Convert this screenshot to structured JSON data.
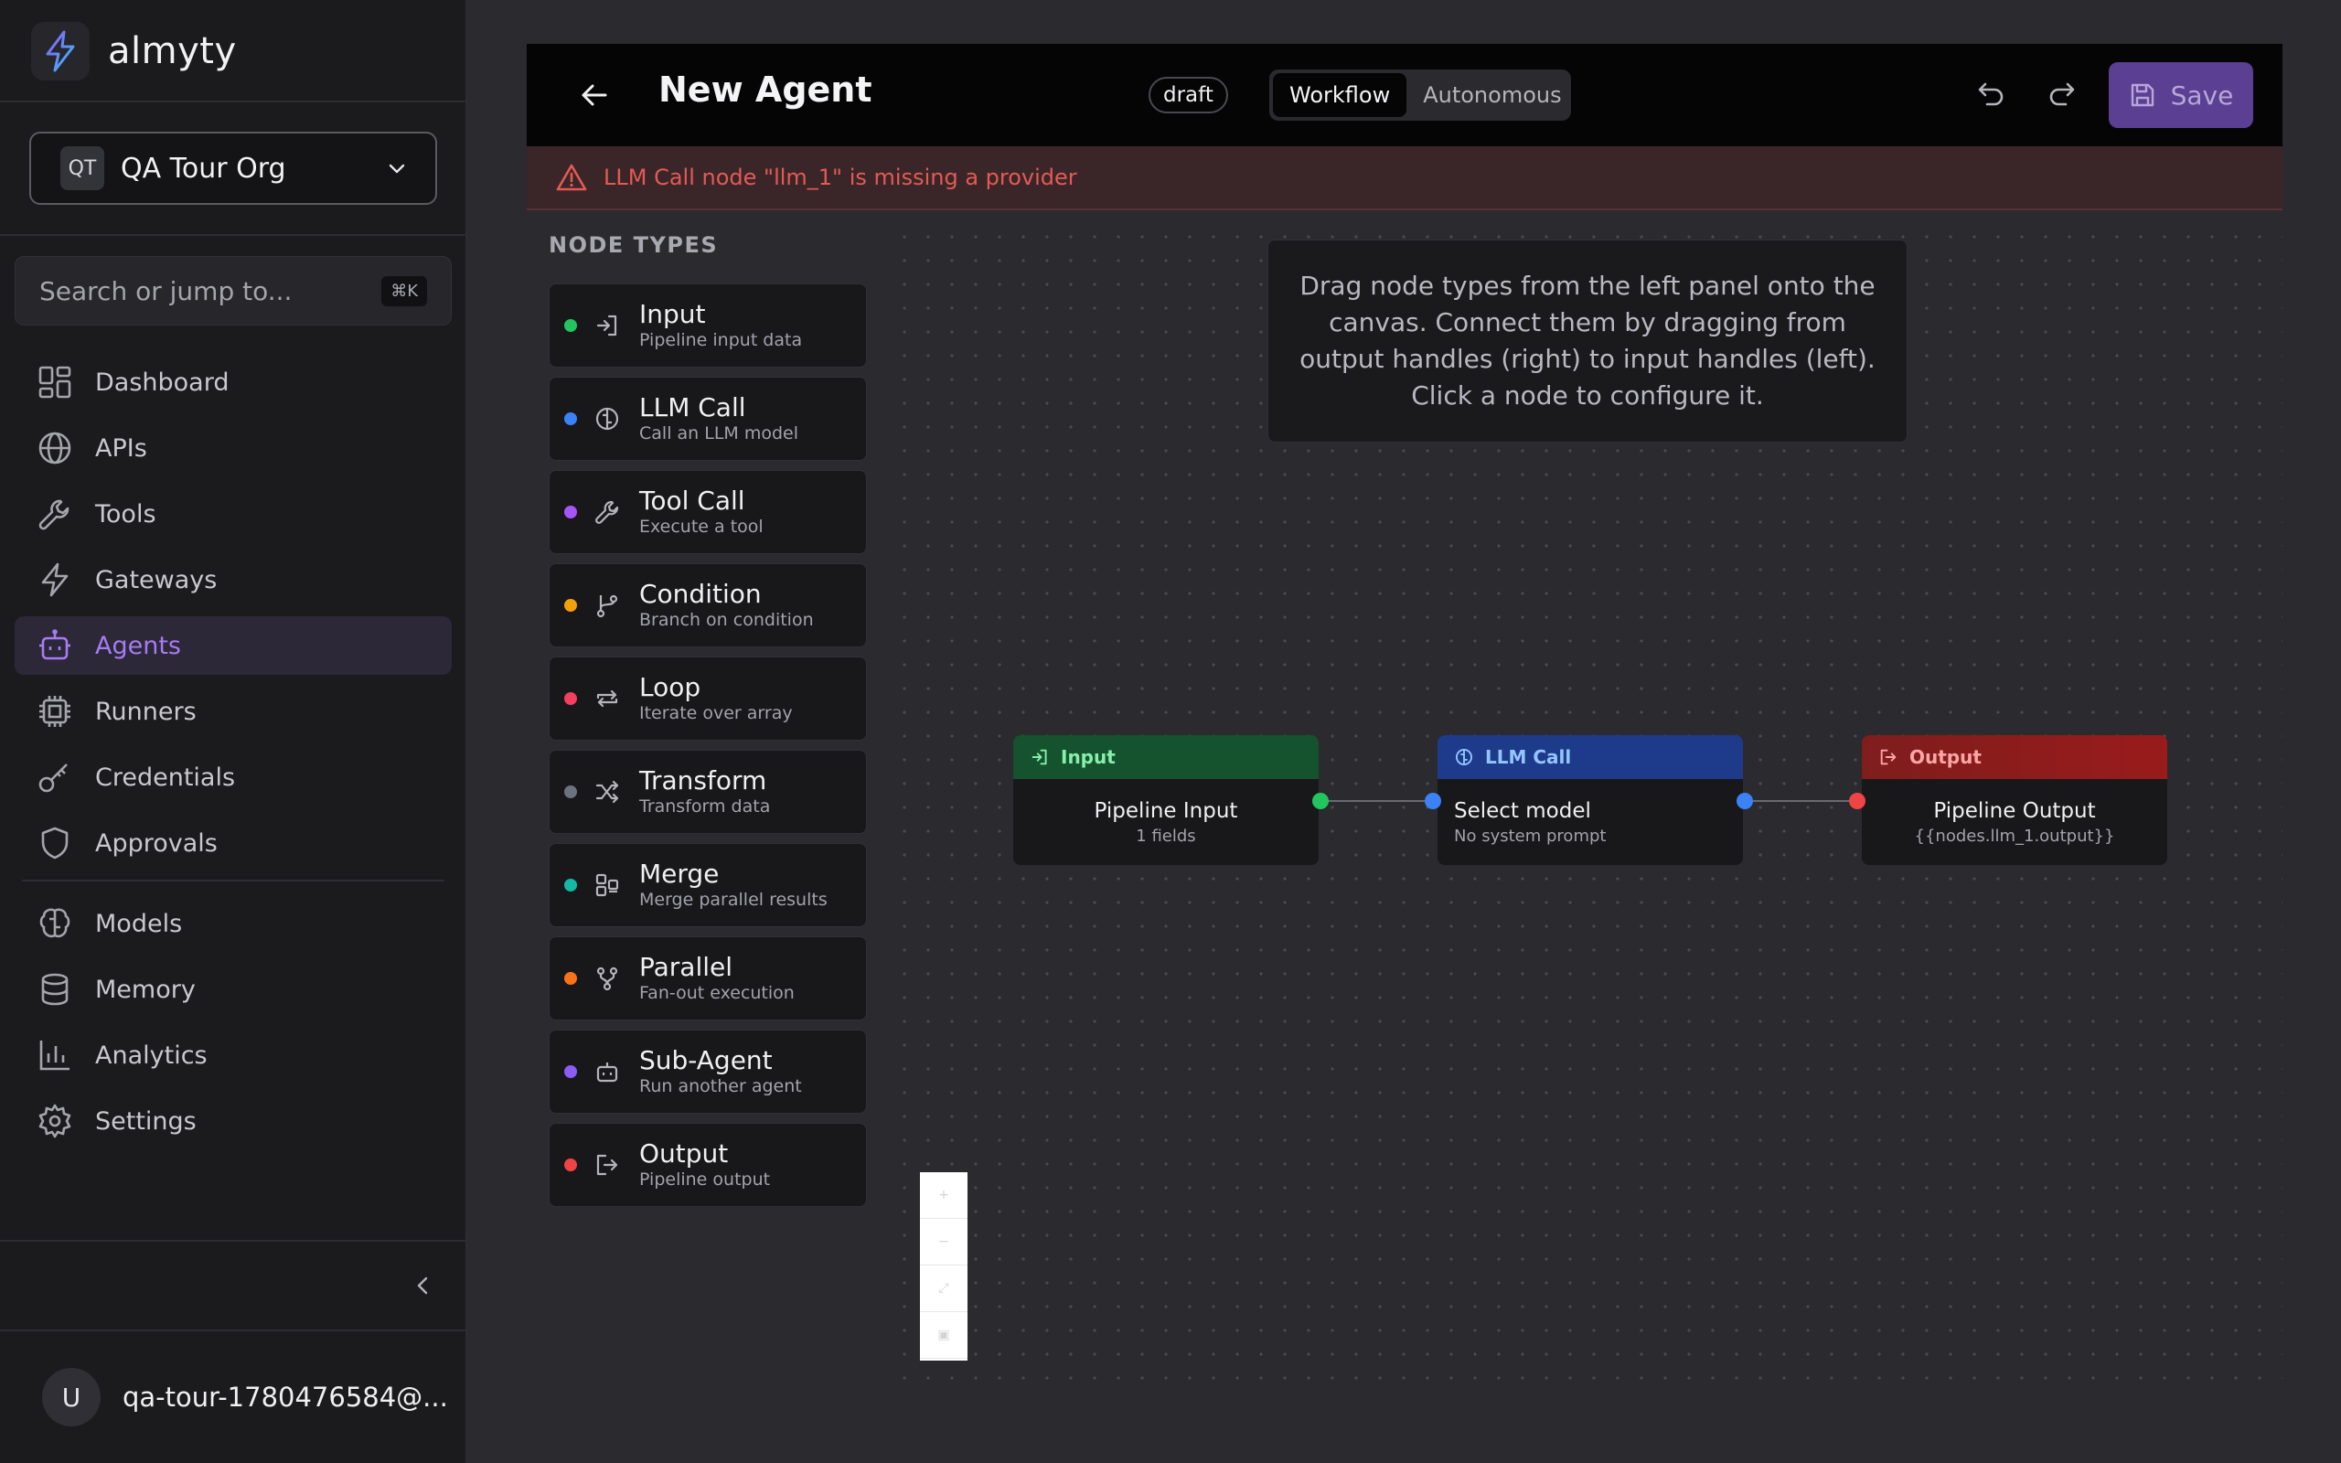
{
  "app": {
    "name": "almyty"
  },
  "org": {
    "initials": "QT",
    "name": "QA Tour Org"
  },
  "search": {
    "placeholder": "Search or jump to...",
    "shortcut": "⌘K"
  },
  "nav": {
    "items": [
      {
        "label": "Dashboard",
        "icon": "dashboard-icon"
      },
      {
        "label": "APIs",
        "icon": "globe-icon"
      },
      {
        "label": "Tools",
        "icon": "wrench-icon"
      },
      {
        "label": "Gateways",
        "icon": "lightning-icon"
      },
      {
        "label": "Agents",
        "icon": "robot-icon",
        "active": true
      },
      {
        "label": "Runners",
        "icon": "cpu-icon"
      },
      {
        "label": "Credentials",
        "icon": "key-icon"
      },
      {
        "label": "Approvals",
        "icon": "shield-icon"
      }
    ],
    "items_secondary": [
      {
        "label": "Models",
        "icon": "brain-icon"
      },
      {
        "label": "Memory",
        "icon": "database-icon"
      },
      {
        "label": "Analytics",
        "icon": "bar-chart-icon"
      },
      {
        "label": "Settings",
        "icon": "gear-icon"
      }
    ]
  },
  "user": {
    "initial": "U",
    "email": "qa-tour-1780476584@..."
  },
  "header": {
    "title": "New Agent",
    "status_badge": "draft",
    "modes": [
      "Workflow",
      "Autonomous"
    ],
    "active_mode": "Workflow",
    "save_label": "Save"
  },
  "error": {
    "message": "LLM Call node \"llm_1\" is missing a provider"
  },
  "node_panel": {
    "title": "NODE TYPES",
    "types": [
      {
        "title": "Input",
        "desc": "Pipeline input data",
        "color": "#22c55e",
        "icon": "enter-icon"
      },
      {
        "title": "LLM Call",
        "desc": "Call an LLM model",
        "color": "#3b82f6",
        "icon": "brain-icon"
      },
      {
        "title": "Tool Call",
        "desc": "Execute a tool",
        "color": "#a855f7",
        "icon": "wrench-icon"
      },
      {
        "title": "Condition",
        "desc": "Branch on condition",
        "color": "#f59e0b",
        "icon": "branch-icon"
      },
      {
        "title": "Loop",
        "desc": "Iterate over array",
        "color": "#f43f5e",
        "icon": "loop-icon"
      },
      {
        "title": "Transform",
        "desc": "Transform data",
        "color": "#6b7280",
        "icon": "shuffle-icon"
      },
      {
        "title": "Merge",
        "desc": "Merge parallel results",
        "color": "#14b8a6",
        "icon": "merge-icon"
      },
      {
        "title": "Parallel",
        "desc": "Fan-out execution",
        "color": "#f97316",
        "icon": "fork-icon"
      },
      {
        "title": "Sub-Agent",
        "desc": "Run another agent",
        "color": "#8b5cf6",
        "icon": "robot-icon"
      },
      {
        "title": "Output",
        "desc": "Pipeline output",
        "color": "#ef4444",
        "icon": "exit-icon"
      }
    ]
  },
  "canvas": {
    "hint": "Drag node types from the left panel onto the canvas. Connect them by dragging from output handles (right) to input handles (left). Click a node to configure it.",
    "nodes": [
      {
        "type_label": "Input",
        "title": "Pipeline Input",
        "subtitle": "1 fields",
        "header_color": "#14532d",
        "label_color": "#86efac"
      },
      {
        "type_label": "LLM Call",
        "title": "Select model",
        "subtitle": "No system prompt",
        "header_color": "#1e3a8a",
        "label_color": "#93c5fd"
      },
      {
        "type_label": "Output",
        "title": "Pipeline Output",
        "subtitle": "{{nodes.llm_1.output}}",
        "header_color": "#7f1d1d",
        "label_color": "#fca5a5"
      }
    ]
  },
  "colors": {
    "accent": "#a77bf3",
    "error": "#e35a55",
    "save_bg": "#5b3f93"
  }
}
